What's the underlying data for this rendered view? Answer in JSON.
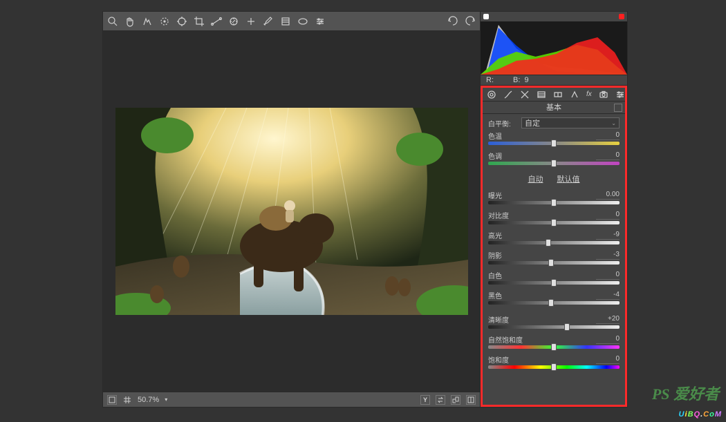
{
  "statusbar": {
    "zoom": "50.7%"
  },
  "rgb": {
    "r_label": "R:",
    "b_label": "B:",
    "b_val": "9"
  },
  "panel": {
    "title": "基本",
    "wb_label": "白平衡:",
    "wb_value": "自定",
    "auto": "自动",
    "default": "默认值",
    "sliders": {
      "temp": {
        "label": "色温",
        "value": "0",
        "pos": 50,
        "track": "track-temp"
      },
      "tint": {
        "label": "色调",
        "value": "0",
        "pos": 50,
        "track": "track-tint"
      },
      "exposure": {
        "label": "曝光",
        "value": "0.00",
        "pos": 50,
        "track": "track-gray"
      },
      "contrast": {
        "label": "对比度",
        "value": "0",
        "pos": 50,
        "track": "track-gray"
      },
      "highlights": {
        "label": "高光",
        "value": "-9",
        "pos": 46,
        "track": "track-gray"
      },
      "shadows": {
        "label": "阴影",
        "value": "-3",
        "pos": 48,
        "track": "track-gray"
      },
      "whites": {
        "label": "白色",
        "value": "0",
        "pos": 50,
        "track": "track-gray"
      },
      "blacks": {
        "label": "黑色",
        "value": "-4",
        "pos": 48,
        "track": "track-gray"
      },
      "clarity": {
        "label": "清晰度",
        "value": "+20",
        "pos": 60,
        "track": "track-gray"
      },
      "vibrance": {
        "label": "自然饱和度",
        "value": "0",
        "pos": 50,
        "track": "track-vib"
      },
      "saturation": {
        "label": "饱和度",
        "value": "0",
        "pos": 50,
        "track": "track-sat"
      }
    }
  },
  "chart_data": {
    "type": "area",
    "title": "Histogram",
    "xlabel": "",
    "ylabel": "",
    "x": [
      0,
      32,
      64,
      96,
      128,
      160,
      192,
      224,
      255
    ],
    "series": [
      {
        "name": "luminance",
        "color": "#dddddd",
        "values": [
          5,
          95,
          48,
          24,
          14,
          10,
          8,
          4,
          0
        ]
      },
      {
        "name": "blue",
        "color": "#0040ff",
        "values": [
          0,
          90,
          55,
          26,
          12,
          4,
          2,
          0,
          0
        ]
      },
      {
        "name": "green",
        "color": "#00d000",
        "values": [
          0,
          30,
          42,
          30,
          40,
          52,
          46,
          14,
          0
        ]
      },
      {
        "name": "red",
        "color": "#ff2020",
        "values": [
          0,
          10,
          24,
          28,
          36,
          56,
          68,
          40,
          0
        ]
      },
      {
        "name": "yellow",
        "color": "#ffe000",
        "values": [
          0,
          18,
          34,
          30,
          40,
          52,
          40,
          12,
          0
        ]
      }
    ],
    "xlim": [
      0,
      255
    ],
    "ylim": [
      0,
      100
    ]
  }
}
